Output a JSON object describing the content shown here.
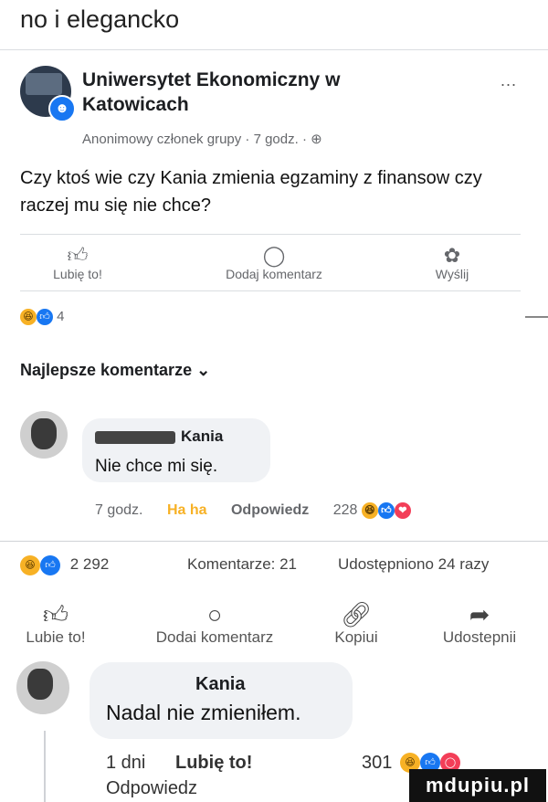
{
  "caption": "no i elegancko",
  "post": {
    "group_name": "Uniwersytet Ekonomiczny w Katowicach",
    "more_label": "...",
    "meta": "Anonimowy członek grupy · 7 godz. · ⊕",
    "text": "Czy ktoś wie czy Kania zmienia egzaminy z finansow czy raczej mu się nie chce?",
    "actions": [
      {
        "label": "Lubię to!",
        "icon": "like-icon"
      },
      {
        "label": "Dodaj komentarz",
        "icon": "comment-icon"
      },
      {
        "label": "Wyślij",
        "icon": "messenger-icon"
      }
    ],
    "reaction_count": "4"
  },
  "best_comments": {
    "label": "Najlepsze komentarze ⌄"
  },
  "comment1": {
    "author": "Kania",
    "text": "Nie chce mi się.",
    "time": "7 godz.",
    "reaction": "Ha ha",
    "reply": "Odpowiedz",
    "count": "228"
  },
  "stats": {
    "reactions": "2 292",
    "comments": "Komentarze: 21",
    "shares": "Udostępniono 24 razy"
  },
  "action_bar": [
    {
      "label": "Lubie to!",
      "icon": "like-icon"
    },
    {
      "label": "Dodai komentarz",
      "icon": "comment-icon"
    },
    {
      "label": "Kopiui",
      "icon": "link-icon"
    },
    {
      "label": "Udostepnii",
      "icon": "share-icon"
    }
  ],
  "comment2": {
    "author": "Kania",
    "text": "Nadal nie zmieniłem.",
    "time": "1 dni",
    "like": "Lubię to!",
    "reply": "Odpowiedz",
    "count": "301"
  },
  "watermark": "mdupiu.pl",
  "colors": {
    "facebook_blue": "#1877f2",
    "haha_yellow": "#f7b125",
    "love_red": "#f33e58"
  }
}
